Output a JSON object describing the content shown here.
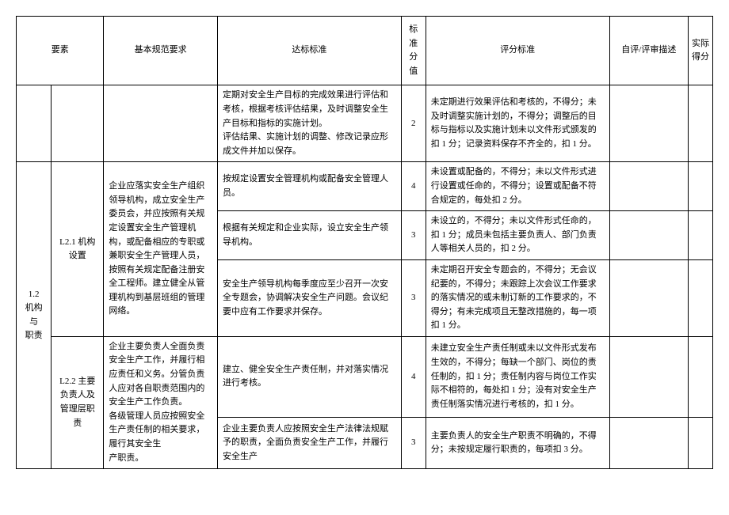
{
  "headers": {
    "yaosu": "要素",
    "jiben": "基本规范要求",
    "dabiao": "达标标准",
    "biaozhun_fenzhi": "标准\n分值",
    "pingfen": "评分标准",
    "ziping": "自评/评审描述",
    "shiji": "实际\n得分"
  },
  "section": {
    "main": "1.2\n机构与\n职责",
    "sub1": "L2.1 机构设置",
    "sub2": "L2.2 主要负责人及管理层职责"
  },
  "jiben": {
    "sub1": "企业应落实安全生产组织领导机构，成立安全生产委员会，并应按照有关规定设置安全生产管理机构，或配备相应的专职或兼职安全生产管理人员，按照有关规定配备注册安全工程师。建立健全从管理机构到基层班组的管理网络。",
    "sub2": "企业主要负责人全面负责安全生产工作，并履行相应责任和义务。分管负责人应对各自职责范围内的安全生产工作负责。\n各级管理人员应按照安全生产责任制的相关要求，履行其安全生\n产职责。"
  },
  "rows": [
    {
      "dabiao": "定期对安全生产目标的完成效果进行评估和考核，根据考核评估结果，及时调整安全生产目标和指标的实施计划。\n评估结果、实施计划的调整、修改记录应形成文件并加以保存。",
      "score": "2",
      "pingfen": "未定期进行效果评估和考核的，不得分；未及时调整实施计划的，不得分；调整后的目标与指标以及实施计划未以文件形式颁发的扣 1 分；记录资料保存不齐全的，扣 1 分。"
    },
    {
      "dabiao": "按规定设置安全管理机构或配备安全管理人员。",
      "score": "4",
      "pingfen": "未设置或配备的，不得分；未以文件形式进行设置或任命的，不得分；设置或配备不符合规定的，每处扣 2 分。"
    },
    {
      "dabiao": "根据有关规定和企业实际，设立安全生产领导机构。",
      "score": "3",
      "pingfen": "未设立的，不得分；未以文件形式任命的，扣 1 分；成员未包括主要负责人、部门负责人等相关人员的，扣 2 分。"
    },
    {
      "dabiao": "安全生产领导机构每季度应至少召开一次安全专题会，协调解决安全生产问题。会议纪要中应有工作要求并保存。",
      "score": "3",
      "pingfen": "未定期召开安全专题会的，不得分；无会议纪要的，不得分；未跟踪上次会议工作要求的落实情况的或未制订新的工作要求的，不得分；有未完成项且无整改措施的，每一项扣 1 分。"
    },
    {
      "dabiao": "建立、健全安全生产责任制，并对落实情况进行考核。",
      "score": "4",
      "pingfen": "未建立安全生产责任制或未以文件形式发布生效的，不得分；每缺一个部门、岗位的责任制的，扣 1 分；责任制内容与岗位工作实际不相符的，每处扣 1 分；没有对安全生产责任制落实情况进行考核的，扣 1 分。"
    },
    {
      "dabiao": "企业主要负责人应按照安全生产法律法规赋予的职责，全面负责安全生产工作，并履行安全生产",
      "score": "3",
      "pingfen": "主要负责人的安全生产职责不明确的，不得分；未按规定履行职责的，每项扣 3 分。"
    }
  ]
}
